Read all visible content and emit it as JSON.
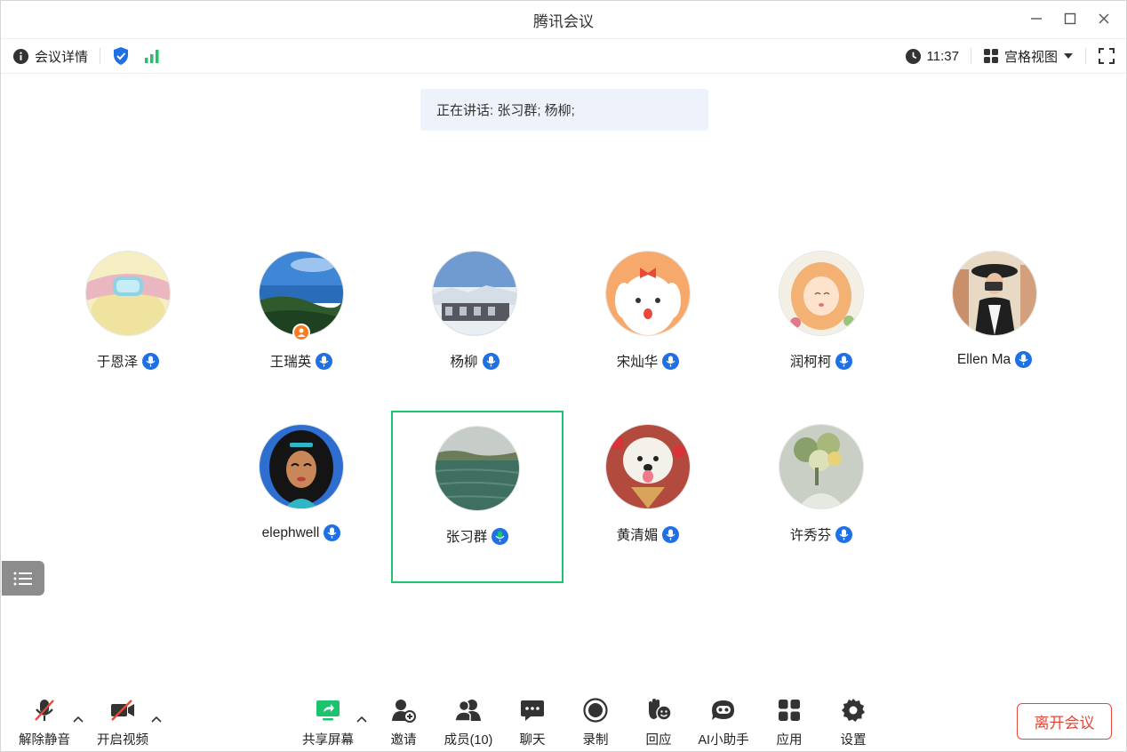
{
  "window": {
    "title": "腾讯会议"
  },
  "infobar": {
    "details_label": "会议详情",
    "time": "11:37",
    "view_label": "宫格视图"
  },
  "speaking": {
    "text": "正在讲话: 张习群; 杨柳;"
  },
  "participants": [
    {
      "name": "于恩泽",
      "mic": "blue"
    },
    {
      "name": "王瑞英",
      "mic": "blue",
      "host": true
    },
    {
      "name": "杨柳",
      "mic": "blue"
    },
    {
      "name": "宋灿华",
      "mic": "blue"
    },
    {
      "name": "润柯柯",
      "mic": "blue"
    },
    {
      "name": "Ellen Ma",
      "mic": "blue"
    },
    {
      "name": "elephwell",
      "mic": "blue"
    },
    {
      "name": "张习群",
      "mic": "green",
      "active": true
    },
    {
      "name": "黄清媚",
      "mic": "blue"
    },
    {
      "name": "许秀芬",
      "mic": "blue"
    }
  ],
  "toolbar": {
    "unmute": "解除静音",
    "video": "开启视频",
    "share": "共享屏幕",
    "invite": "邀请",
    "members": "成员(10)",
    "chat": "聊天",
    "record": "录制",
    "react": "回应",
    "ai": "AI小助手",
    "apps": "应用",
    "settings": "设置",
    "leave": "离开会议"
  },
  "colors": {
    "accent_blue": "#1f6fe5",
    "speaking_green": "#1ec36f",
    "leave_red": "#e5483b",
    "signal_green": "#22c46b"
  }
}
